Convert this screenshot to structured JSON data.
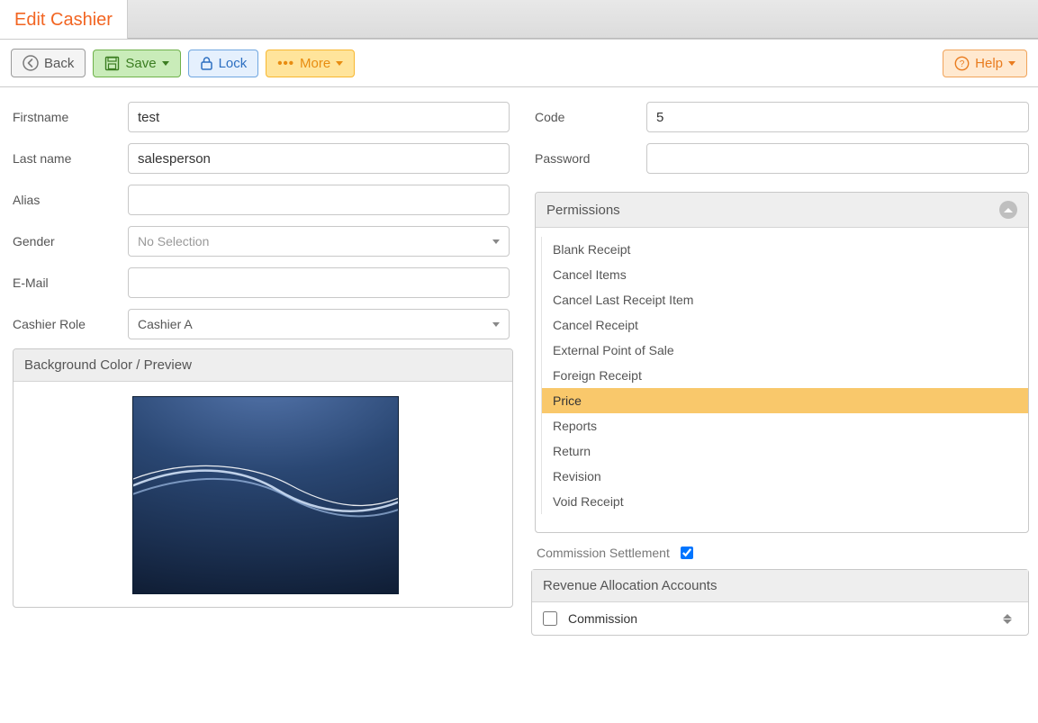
{
  "page_title": "Edit Cashier",
  "toolbar": {
    "back": "Back",
    "save": "Save",
    "lock": "Lock",
    "more": "More",
    "help": "Help"
  },
  "left_form": {
    "firstname_label": "Firstname",
    "firstname_value": "test",
    "lastname_label": "Last name",
    "lastname_value": "salesperson",
    "alias_label": "Alias",
    "alias_value": "",
    "gender_label": "Gender",
    "gender_value": "No Selection",
    "email_label": "E-Mail",
    "email_value": "",
    "role_label": "Cashier Role",
    "role_value": "Cashier A"
  },
  "preview_panel": {
    "title": "Background Color / Preview"
  },
  "right_form": {
    "code_label": "Code",
    "code_value": "5",
    "password_label": "Password",
    "password_value": ""
  },
  "permissions_panel": {
    "title": "Permissions",
    "items": [
      "Blank Receipt",
      "Cancel Items",
      "Cancel Last Receipt Item",
      "Cancel Receipt",
      "External Point of Sale",
      "Foreign Receipt",
      "Price",
      "Reports",
      "Return",
      "Revision",
      "Void Receipt"
    ],
    "selected_index": 6
  },
  "commission": {
    "label": "Commission Settlement",
    "checked": true
  },
  "revenue_panel": {
    "title": "Revenue Allocation Accounts",
    "item_label": "Commission",
    "item_checked": false
  }
}
